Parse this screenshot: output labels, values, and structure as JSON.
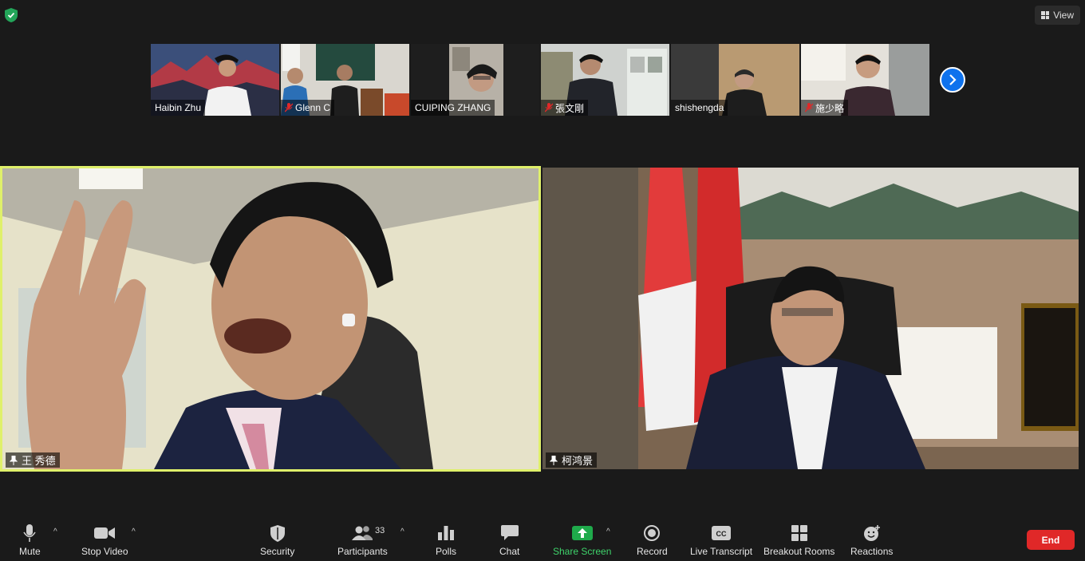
{
  "top": {
    "view_label": "View"
  },
  "thumbnails": [
    {
      "name": "Haibin Zhu",
      "muted": false
    },
    {
      "name": "Glenn C",
      "muted": true
    },
    {
      "name": "CUIPING ZHANG",
      "muted": false
    },
    {
      "name": "張文剛",
      "muted": true
    },
    {
      "name": "shishengda",
      "muted": false
    },
    {
      "name": "施少略",
      "muted": true
    }
  ],
  "speakers": {
    "left": {
      "name": "王 秀德",
      "pinned": true
    },
    "right": {
      "name": "柯鸿景",
      "pinned": true
    }
  },
  "toolbar": {
    "mute": "Mute",
    "stop_video": "Stop Video",
    "security": "Security",
    "participants": "Participants",
    "participants_count": "33",
    "polls": "Polls",
    "chat": "Chat",
    "share_screen": "Share Screen",
    "record": "Record",
    "live_transcript": "Live Transcript",
    "breakout_rooms": "Breakout Rooms",
    "reactions": "Reactions",
    "end": "End"
  },
  "colors": {
    "active_speaker_border": "#dff06a",
    "share_green": "#3fd36b",
    "end_red": "#e02828",
    "next_blue": "#0e72ed"
  }
}
